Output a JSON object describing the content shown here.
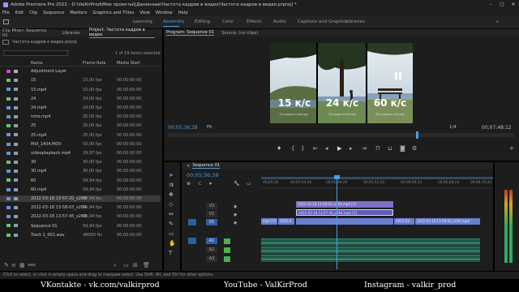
{
  "titlebar": {
    "title": "Adobe Premiere Pro 2022 - D:\\ValKirProd\\Мои проекты\\[Данинные\\Частота кадров в видео\\Частота кадров в видео.prproj] *"
  },
  "window_controls": [
    "–",
    "▢",
    "✕"
  ],
  "menu": [
    "File",
    "Edit",
    "Clip",
    "Sequence",
    "Markers",
    "Graphics and Titles",
    "View",
    "Window",
    "Help"
  ],
  "workspaces": [
    "Learning",
    "Assembly",
    "Editing",
    "Color",
    "Effects",
    "Audio",
    "Captions and Graphics",
    "Libraries"
  ],
  "active_workspace": "Assembly",
  "left_header_tabs": [
    "Clip Mixer: Sequence 01",
    "Libraries"
  ],
  "project": {
    "tab_label": "Project: Частота кадров в видео",
    "file_label": "Частота кадров в видео.prproj",
    "items_selected": "1 of 19 items selected",
    "columns": {
      "name": "Name",
      "frame_rate": "Frame Rate",
      "media_start": "Media Start"
    },
    "items": [
      {
        "name": "Adjustment Layer",
        "frame_rate": "",
        "media_start": "",
        "swatch": "#c44fc4",
        "icon": "#b0b0c8"
      },
      {
        "name": "15",
        "frame_rate": "15,00 fps",
        "media_start": "00:00:00:00",
        "swatch": "#6bc46b",
        "icon": "#8aa0b8"
      },
      {
        "name": "15.mp4",
        "frame_rate": "15,00 fps",
        "media_start": "00:00:00:00",
        "swatch": "#6b8fe0",
        "icon": "#8aa0b8"
      },
      {
        "name": "24",
        "frame_rate": "24,00 fps",
        "media_start": "00:00:00:00",
        "swatch": "#6bc46b",
        "icon": "#8aa0b8"
      },
      {
        "name": "24.mp4",
        "frame_rate": "24,00 fps",
        "media_start": "00:00:00:00",
        "swatch": "#6b8fe0",
        "icon": "#8aa0b8"
      },
      {
        "name": "intro.mp4",
        "frame_rate": "25,00 fps",
        "media_start": "00:00:00:00",
        "swatch": "#6b8fe0",
        "icon": "#8aa0b8"
      },
      {
        "name": "25",
        "frame_rate": "25,00 fps",
        "media_start": "00:00:00:00",
        "swatch": "#6bc46b",
        "icon": "#8aa0b8"
      },
      {
        "name": "25.mp4",
        "frame_rate": "25,00 fps",
        "media_start": "00:00:00:00",
        "swatch": "#6b8fe0",
        "icon": "#8aa0b8"
      },
      {
        "name": "MVI_1404.MOV",
        "frame_rate": "50,00 fps",
        "media_start": "00:00:00:00",
        "swatch": "#6b8fe0",
        "icon": "#8aa0b8"
      },
      {
        "name": "videoplayback.mp4",
        "frame_rate": "29,97 fps",
        "media_start": "00:00:00:00",
        "swatch": "#6b8fe0",
        "icon": "#8aa0b8"
      },
      {
        "name": "30",
        "frame_rate": "30,00 fps",
        "media_start": "00:00:00:00",
        "swatch": "#6bc46b",
        "icon": "#8aa0b8"
      },
      {
        "name": "30.mp4",
        "frame_rate": "30,00 fps",
        "media_start": "00:00:00:00",
        "swatch": "#6b8fe0",
        "icon": "#8aa0b8"
      },
      {
        "name": "60",
        "frame_rate": "59,94 fps",
        "media_start": "00:00:00:00",
        "swatch": "#6bc46b",
        "icon": "#8aa0b8"
      },
      {
        "name": "60.mp4",
        "frame_rate": "59,94 fps",
        "media_start": "00:00:00:00",
        "swatch": "#6b8fe0",
        "icon": "#8aa0b8"
      },
      {
        "name": "2022-03-18 13-57-20_x264",
        "frame_rate": "59,94 fps",
        "media_start": "00:00:00:00",
        "swatch": "#6b8fe0",
        "icon": "#8aa0b8",
        "selected": true
      },
      {
        "name": "2022-03-18 13-58-03_x264",
        "frame_rate": "59,94 fps",
        "media_start": "00:00:00:00",
        "swatch": "#6b8fe0",
        "icon": "#8aa0b8"
      },
      {
        "name": "2022-03-18 13-57-45_x264",
        "frame_rate": "59,94 fps",
        "media_start": "00:00:00:00",
        "swatch": "#6b8fe0",
        "icon": "#8aa0b8"
      },
      {
        "name": "Sequence 01",
        "frame_rate": "59,94 fps",
        "media_start": "00:00:00:00",
        "swatch": "#6bc46b",
        "icon": "#8aa0b8"
      },
      {
        "name": "Track 1_001.wav",
        "frame_rate": "48000 Hz",
        "media_start": "00:00:00:00",
        "swatch": "#6bc46b",
        "icon": "#8aa0b8"
      }
    ]
  },
  "program": {
    "tabs": [
      "Program: Sequence 01",
      "Source: (no clips)"
    ],
    "frames": [
      {
        "label": "15 к/с",
        "caption": "15 кадров в секунду"
      },
      {
        "label": "24 к/с",
        "caption": "24 кадра в секунду"
      },
      {
        "label": "60 к/с",
        "caption": "60 кадров в секунду"
      }
    ],
    "timecode": "00;05;36;39",
    "fit": "Fit",
    "quality": "1/4",
    "duration": "00;07;48;12"
  },
  "sequence": {
    "tab": "Sequence 01",
    "timecode": "00;05;36;39",
    "ruler_ticks": [
      "00;05;36",
      "00;05;44;20",
      "00;05;49;20",
      "00;05;52;20",
      "00;06;00;24",
      "00;06;08;24",
      "00;06;16;24"
    ],
    "video_tracks": [
      "V3",
      "V2",
      "V1"
    ],
    "audio_tracks": [
      "A1",
      "A2",
      "A3"
    ],
    "clips": {
      "v3": "2022-03-18 13-58-03_x264.mp4 [V]",
      "v2": "2022-03-18 13-57-45_x264.mp4 [V]",
      "v1a": "2022-0",
      "v1b": "2022-03-",
      "v1c": "2022-03-18 13-58-03_x264.mp4"
    }
  },
  "status_bar": "Click to select, or click in empty space and drag to marquee select. Use Shift, Alt, and Ctrl for other options.",
  "credits": [
    "VKontakte - vk.com/valkirprod",
    "YouTube - ValKirProd",
    "Instagram - valkir_prod"
  ],
  "colors": {
    "accent": "#4a9ee0",
    "timeline_playhead": "#4a9ee0",
    "clip_video": "#6b7fd0",
    "clip_audio": "#1f5a4a"
  }
}
